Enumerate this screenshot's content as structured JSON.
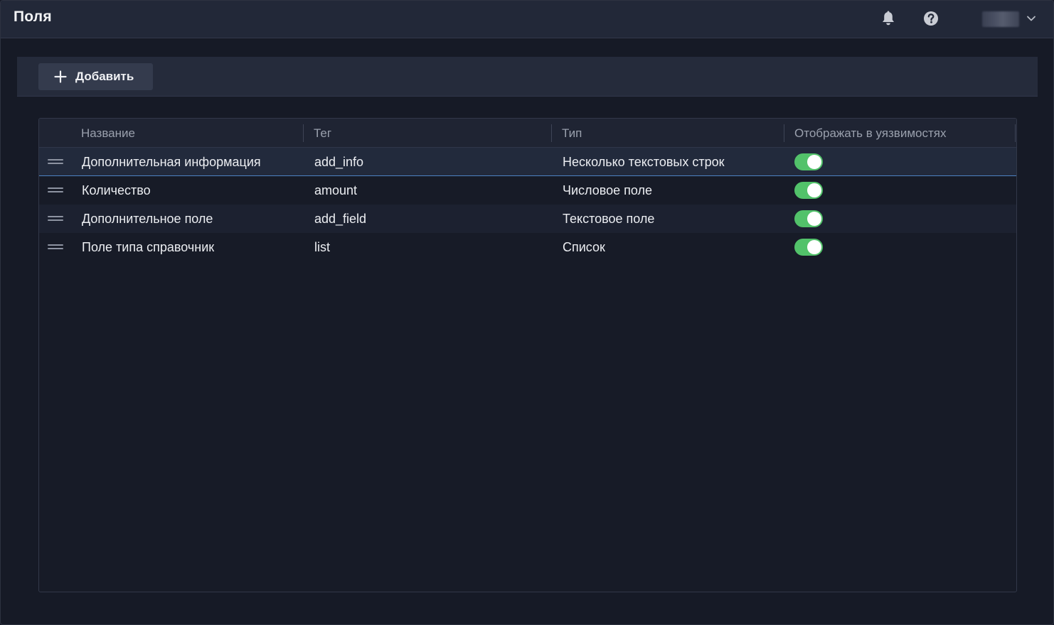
{
  "header": {
    "title": "Поля",
    "icons": [
      "bell-icon",
      "help-icon",
      "chevron-down-icon"
    ]
  },
  "toolbar": {
    "add_label": "Добавить"
  },
  "table": {
    "columns": [
      "Название",
      "Тег",
      "Тип",
      "Отображать в уязвимостях"
    ],
    "rows": [
      {
        "name": "Дополнительная информация",
        "tag": "add_info",
        "type": "Несколько текстовых строк",
        "show_in_vulns": true,
        "selected": true
      },
      {
        "name": "Количество",
        "tag": "amount",
        "type": "Числовое поле",
        "show_in_vulns": true,
        "selected": false
      },
      {
        "name": "Дополнительное поле",
        "tag": "add_field",
        "type": "Текстовое поле",
        "show_in_vulns": true,
        "selected": false
      },
      {
        "name": "Поле типа справочник",
        "tag": "list",
        "type": "Список",
        "show_in_vulns": true,
        "selected": false
      }
    ]
  },
  "colors": {
    "toggle_on": "#52c26a",
    "selected_border": "#4d82c4",
    "background": "#161a26"
  }
}
